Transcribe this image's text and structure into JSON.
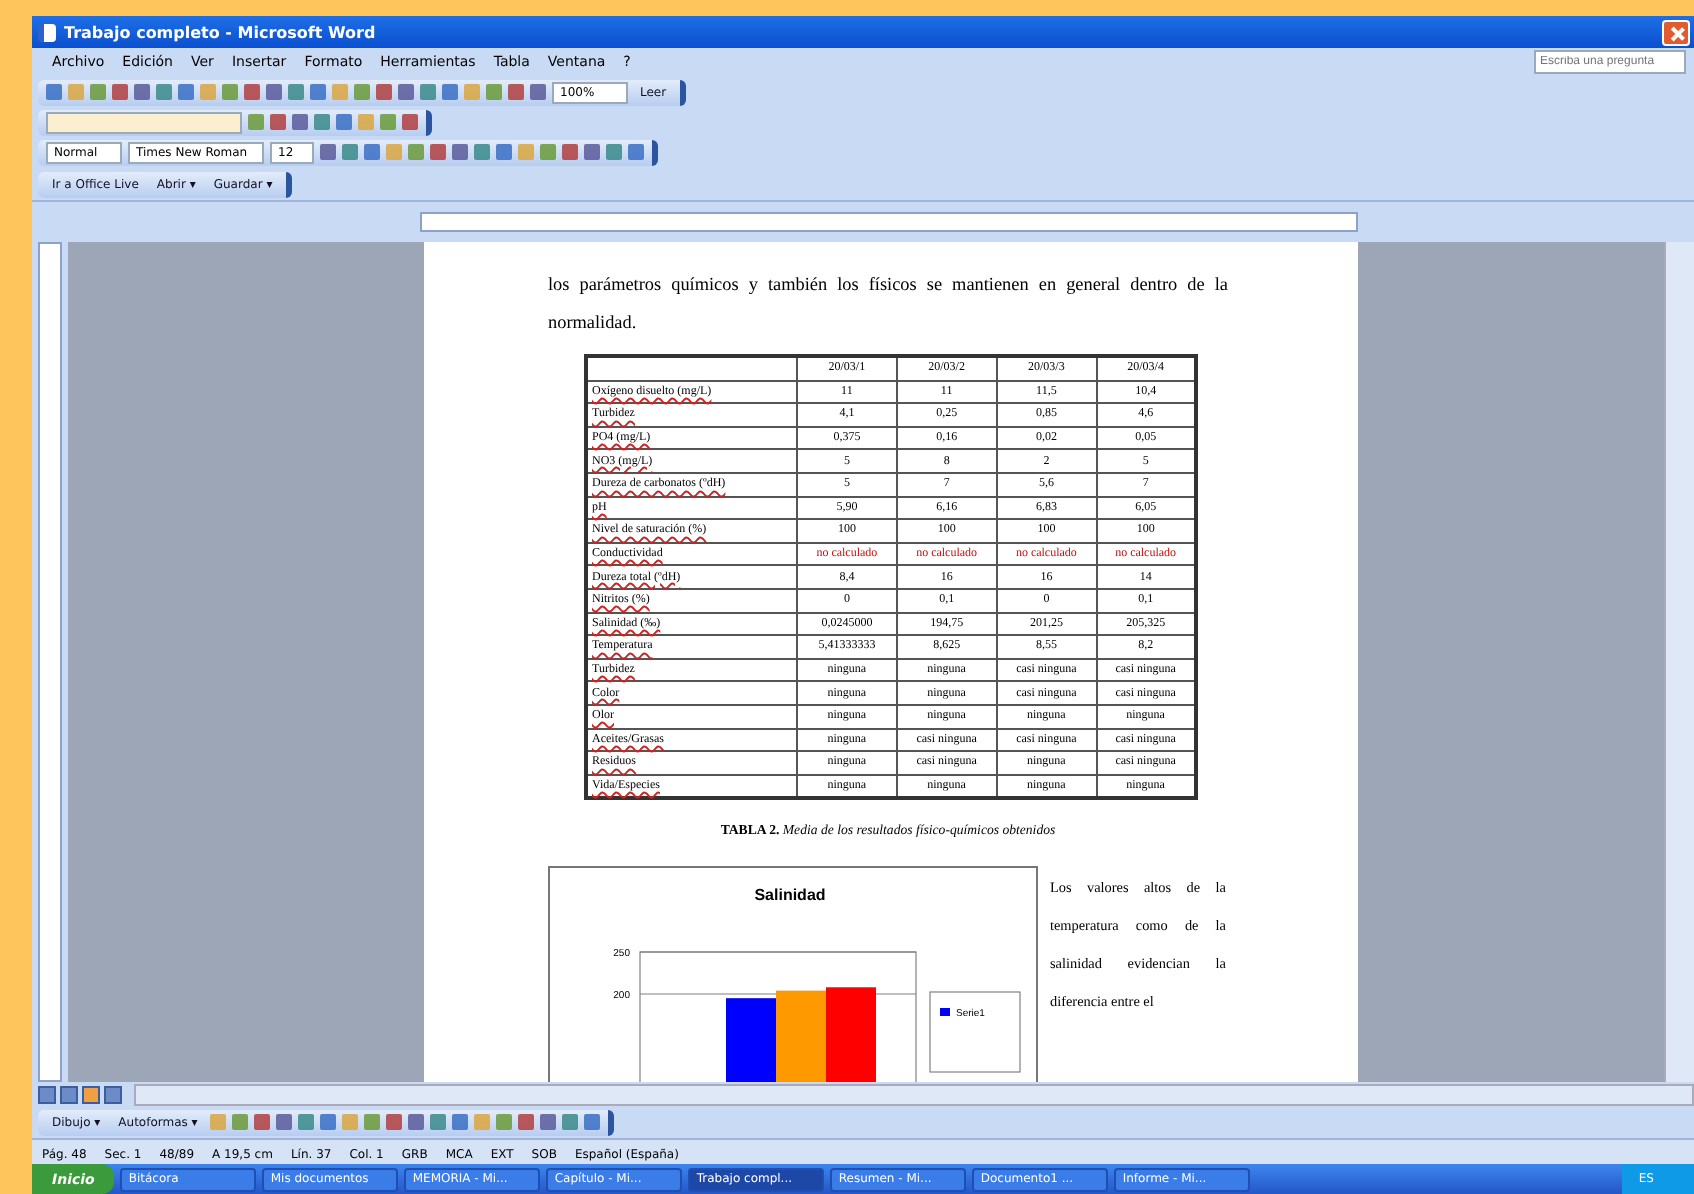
{
  "window": {
    "title": "Trabajo completo - Microsoft Word"
  },
  "menu": [
    "Archivo",
    "Edición",
    "Ver",
    "Insertar",
    "Formato",
    "Herramientas",
    "Tabla",
    "Ventana",
    "?"
  ],
  "help_search": {
    "placeholder": "Escriba una pregunta"
  },
  "standard_toolbar": {
    "zoom": "100%",
    "read_button": "Leer"
  },
  "formatting_toolbar": {
    "style": "Normal",
    "font": "Times New Roman",
    "size": "12"
  },
  "office_live_toolbar": {
    "items": [
      "Ir a Office Live",
      "Abrir ▾",
      "Guardar ▾"
    ]
  },
  "document": {
    "intro": "los parámetros químicos y también los físicos se mantienen en general dentro de la normalidad.",
    "table": {
      "columns": [
        "20/03/1",
        "20/03/2",
        "20/03/3",
        "20/03/4"
      ],
      "rows": [
        {
          "label": "Oxígeno disuelto (mg/L)",
          "cells": [
            "11",
            "11",
            "11,5",
            "10,4"
          ],
          "kind": "value"
        },
        {
          "label": "Turbidez",
          "cells": [
            "4,1",
            "0,25",
            "0,85",
            "4,6"
          ],
          "kind": "value"
        },
        {
          "label": "PO4 (mg/L)",
          "cells": [
            "0,375",
            "0,16",
            "0,02",
            "0,05"
          ],
          "kind": "value"
        },
        {
          "label": "NO3 (mg/L)",
          "cells": [
            "5",
            "8",
            "2",
            "5"
          ],
          "kind": "value"
        },
        {
          "label": "Dureza de carbonatos (ºdH)",
          "cells": [
            "5",
            "7",
            "5,6",
            "7"
          ],
          "kind": "value"
        },
        {
          "label": "pH",
          "cells": [
            "5,90",
            "6,16",
            "6,83",
            "6,05"
          ],
          "kind": "value"
        },
        {
          "label": "Nivel de saturación (%)",
          "cells": [
            "100",
            "100",
            "100",
            "100"
          ],
          "kind": "value"
        },
        {
          "label": "Conductividad",
          "cells": [
            "no calculado",
            "no calculado",
            "no calculado",
            "no calculado"
          ],
          "kind": "missing"
        },
        {
          "label": "Dureza total (ºdH)",
          "cells": [
            "8,4",
            "16",
            "16",
            "14"
          ],
          "kind": "value"
        },
        {
          "label": "Nitritos (%)",
          "cells": [
            "0",
            "0,1",
            "0",
            "0,1"
          ],
          "kind": "value"
        },
        {
          "label": "Salinidad (‰)",
          "cells": [
            "0,0245000",
            "194,75",
            "201,25",
            "205,325"
          ],
          "kind": "value"
        },
        {
          "label": "Temperatura",
          "cells": [
            "5,41333333",
            "8,625",
            "8,55",
            "8,2"
          ],
          "kind": "value"
        },
        {
          "label": "Turbidez",
          "cells": [
            "ninguna",
            "ninguna",
            "casi ninguna",
            "casi ninguna"
          ],
          "kind": "value"
        },
        {
          "label": "Color",
          "cells": [
            "ninguna",
            "ninguna",
            "casi ninguna",
            "casi ninguna"
          ],
          "kind": "value"
        },
        {
          "label": "Olor",
          "cells": [
            "ninguna",
            "ninguna",
            "ninguna",
            "ninguna"
          ],
          "kind": "value"
        },
        {
          "label": "Aceites/Grasas",
          "cells": [
            "ninguna",
            "casi ninguna",
            "casi ninguna",
            "casi ninguna"
          ],
          "kind": "value"
        },
        {
          "label": "Residuos",
          "cells": [
            "ninguna",
            "casi ninguna",
            "ninguna",
            "casi ninguna"
          ],
          "kind": "value"
        },
        {
          "label": "Vida/Especies",
          "cells": [
            "ninguna",
            "ninguna",
            "ninguna",
            "ninguna"
          ],
          "kind": "value"
        }
      ]
    },
    "caption": "**TABLA 2.** *Media de los resultados físico-químicos obtenidos*",
    "chart": {
      "chart_data": {
        "type": "bar",
        "title": "Salinidad",
        "ylim": [
          0,
          250
        ],
        "yticks": [
          200,
          250
        ],
        "series": [
          {
            "name": "Serie1",
            "color": "#0000ff",
            "values": [
              195
            ]
          },
          {
            "color": "#ff9900",
            "values": [
              204
            ]
          },
          {
            "color": "#ff0000",
            "values": [
              208
            ]
          }
        ]
      }
    },
    "side_text": "Los valores altos de la temperatura como de la salinidad evidencian la diferencia entre el"
  },
  "drawing_toolbar": [
    "Dibujo ▾",
    "Autoformas ▾"
  ],
  "status_bar": [
    "Pág. 48",
    "Sec. 1",
    "48/89",
    "A 19,5 cm",
    "Lín. 37",
    "Col. 1",
    "GRB",
    "MCA",
    "EXT",
    "SOB",
    "Español (España)"
  ],
  "taskbar": {
    "start": "Inicio",
    "items": [
      {
        "label": "Bitácora",
        "selected": false
      },
      {
        "label": "Mis documentos",
        "selected": false
      },
      {
        "label": "MEMORIA - Mi...",
        "selected": false
      },
      {
        "label": "Capítulo - Mi...",
        "selected": false
      },
      {
        "label": "Trabajo compl...",
        "selected": true
      },
      {
        "label": "Resumen - Mi...",
        "selected": false
      },
      {
        "label": "Documento1 ...",
        "selected": false
      },
      {
        "label": "Informe - Mi...",
        "selected": false
      }
    ],
    "clock": "ES"
  }
}
